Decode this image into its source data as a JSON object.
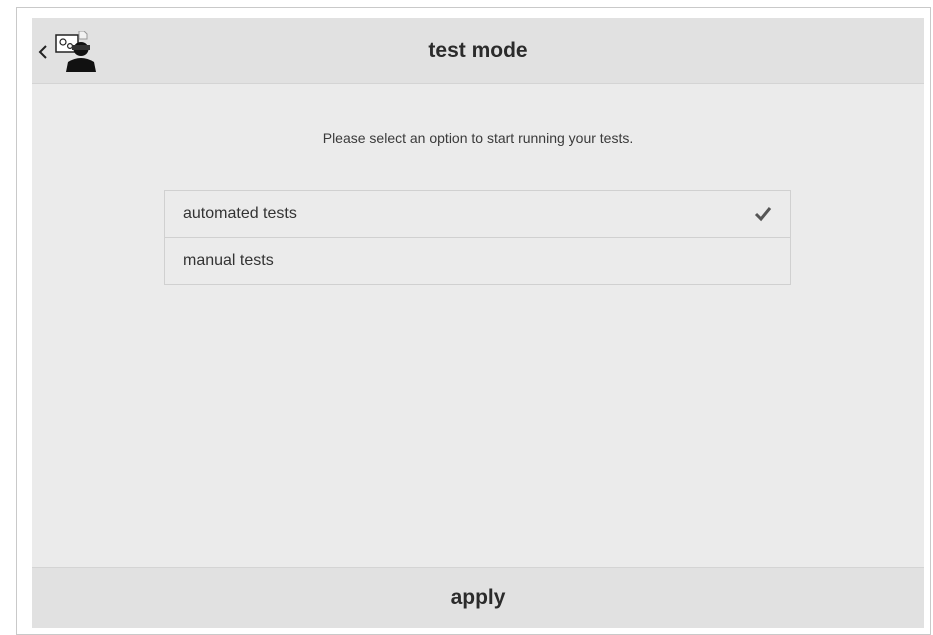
{
  "header": {
    "title": "test mode",
    "back_icon": "chevron-left-icon",
    "mode_icon": "test-operator-icon"
  },
  "main": {
    "instruction": "Please select an option to start running your tests.",
    "options": [
      {
        "label": "automated tests",
        "selected": true
      },
      {
        "label": "manual tests",
        "selected": false
      }
    ],
    "selected_icon": "checkmark-icon"
  },
  "footer": {
    "apply_label": "apply"
  },
  "colors": {
    "background": "#ebebeb",
    "bar": "#e1e1e1",
    "text": "#2b2b2b",
    "checkmark": "#555555"
  }
}
